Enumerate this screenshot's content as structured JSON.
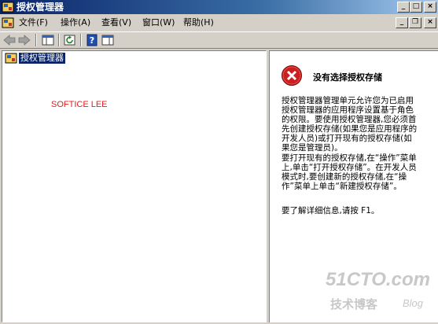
{
  "window": {
    "title": "授权管理器",
    "minimize_glyph": "_",
    "maximize_glyph": "□",
    "close_glyph": "×"
  },
  "menubar": {
    "items": [
      {
        "label": "文件(F)"
      },
      {
        "label": "操作(A)"
      },
      {
        "label": "查看(V)"
      },
      {
        "label": "窗口(W)"
      },
      {
        "label": "帮助(H)"
      }
    ],
    "mdi_min_glyph": "_",
    "mdi_restore_glyph": "❐",
    "mdi_close_glyph": "×"
  },
  "toolbar": {
    "icons": [
      "back-arrow-icon",
      "forward-arrow-icon",
      "show-tree-icon",
      "refresh-icon",
      "help-icon",
      "show-action-pane-icon"
    ]
  },
  "tree": {
    "root_label": "授权管理器"
  },
  "annotation": "SOFTICE LEE",
  "details": {
    "title": "没有选择授权存储",
    "para1": "授权管理器管理单元允许您为已启用授权管理器的应用程序设置基于角色的权限。要使用授权管理器,您必须首先创建授权存储(如果您是应用程序的开发人员)或打开现有的授权存储(如果您是管理员)。",
    "para2": "要打开现有的授权存储,在“操作”菜单上,单击“打开授权存储”。在开发人员模式时,要创建新的授权存储,在“操作”菜单上单击“新建授权存储”。",
    "para3": "要了解详细信息,请按 F1。"
  },
  "watermark": {
    "line1": "51CTO.com",
    "line2": "技术博客",
    "line3": "Blog"
  },
  "colors": {
    "titlebar": "#0a246a",
    "error_red": "#cc1f1f",
    "annotation_red": "#e02020",
    "selection": "#0a246a"
  }
}
